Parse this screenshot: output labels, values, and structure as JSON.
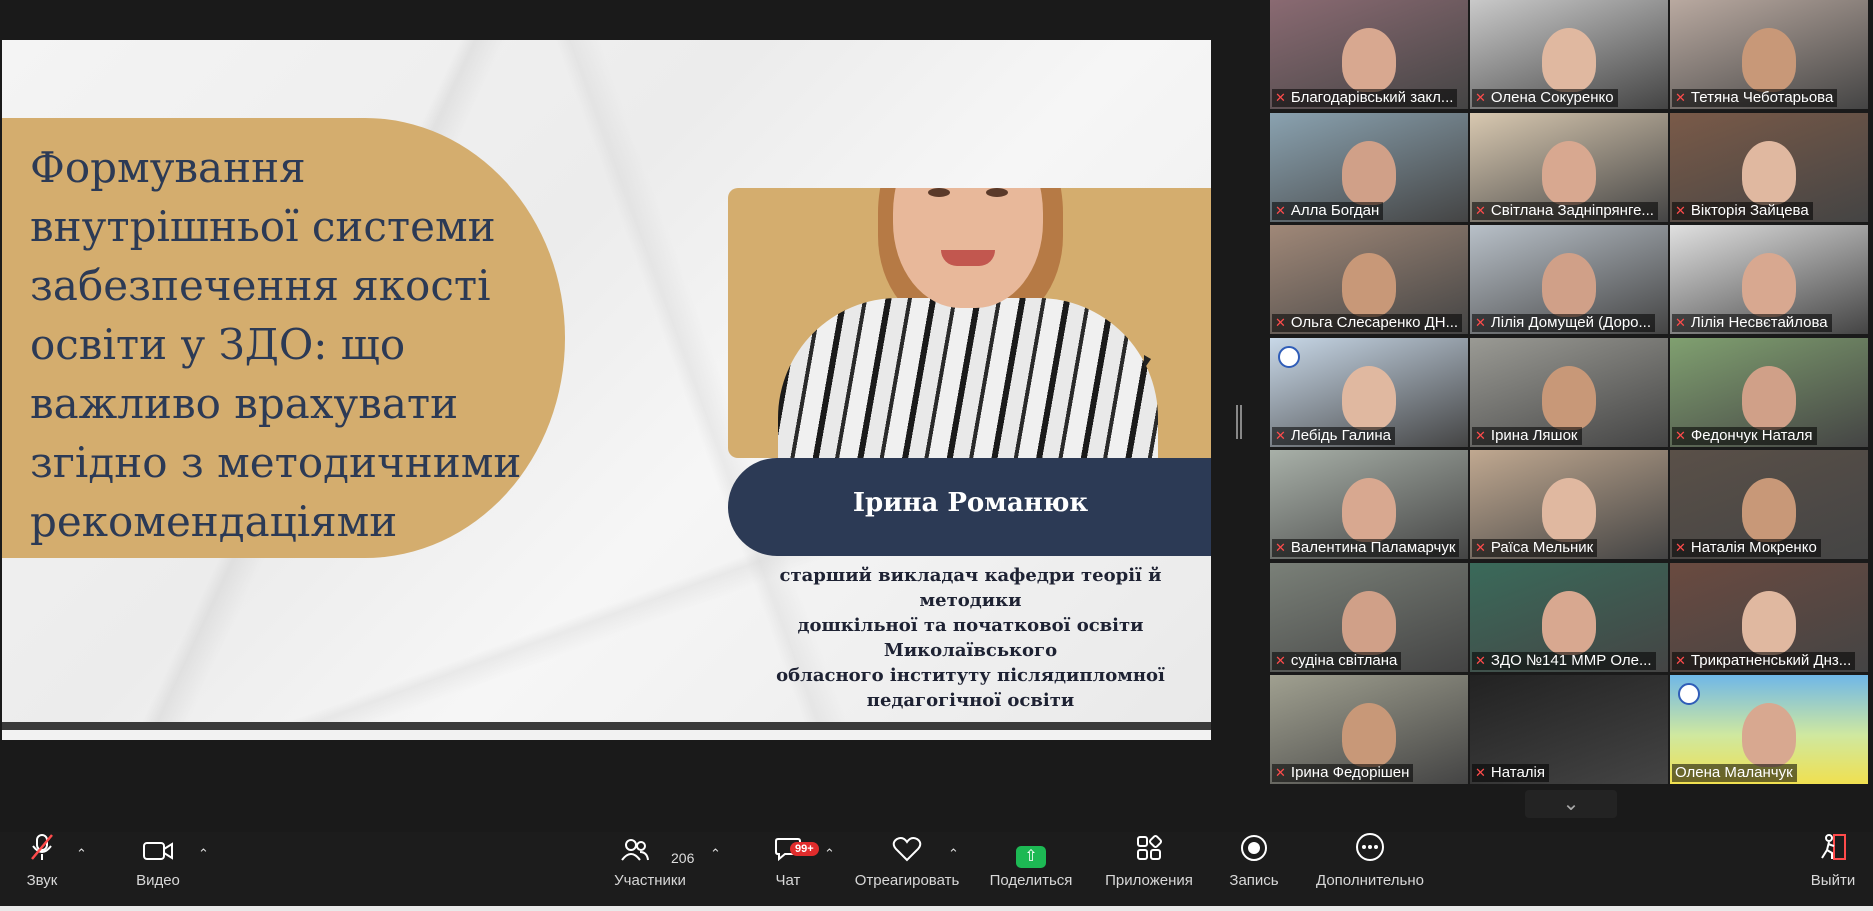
{
  "slide": {
    "title": " Формування\nвнутрішньої системи\nзабезпечення якості\nосвіти у ЗДО: що\nважливо врахувати\nзгідно з методичними\nрекомендаціями",
    "speaker_name": "Ірина Романюк",
    "speaker_role": "старший викладач кафедри теорії й методики\nдошкільної та початкової освіти Миколаївського\nобласного інституту післядипломної\nпедагогічної освіти"
  },
  "gallery": {
    "participants": [
      {
        "name": "Благодарівський закл...",
        "muted": true
      },
      {
        "name": "Олена Сокуренко",
        "muted": true
      },
      {
        "name": "Тетяна Чеботарьова",
        "muted": true
      },
      {
        "name": "Алла Богдан",
        "muted": true
      },
      {
        "name": "Світлана Задніпрянге...",
        "muted": true
      },
      {
        "name": "Вікторія Зайцева",
        "muted": true
      },
      {
        "name": "Ольга Слесаренко ДН...",
        "muted": true
      },
      {
        "name": "Лілія Домущей (Доро...",
        "muted": true
      },
      {
        "name": "Лілія Несвєтайлова",
        "muted": true
      },
      {
        "name": "Лебідь Галина",
        "muted": true
      },
      {
        "name": "Ірина Ляшок",
        "muted": true
      },
      {
        "name": "Федончук Наталя",
        "muted": true
      },
      {
        "name": "Валентина Паламарчук",
        "muted": true
      },
      {
        "name": "Раїса Мельник",
        "muted": true
      },
      {
        "name": "Наталія Мокренко",
        "muted": true
      },
      {
        "name": "судіна світлана",
        "muted": true
      },
      {
        "name": "ЗДО №141 ММР Оле...",
        "muted": true
      },
      {
        "name": "Трикратненський Днз...",
        "muted": true
      },
      {
        "name": "Ірина Федорішен",
        "muted": true
      },
      {
        "name": "Наталія",
        "muted": true
      },
      {
        "name": "Олена Маланчук",
        "muted": false,
        "active": true
      }
    ],
    "more_icon": "chevron-down-icon"
  },
  "toolbar": {
    "audio_label": "Звук",
    "video_label": "Видео",
    "participants_label": "Участники",
    "participants_count": "206",
    "chat_label": "Чат",
    "chat_badge": "99+",
    "react_label": "Отреагировать",
    "share_label": "Поделиться",
    "apps_label": "Приложения",
    "record_label": "Запись",
    "more_label": "Дополнительно",
    "leave_label": "Выйти"
  },
  "colors": {
    "accent_gold": "#d4ad6e",
    "navy": "#2c3a55",
    "share_green": "#1db954",
    "active_speaker": "#2ddf6a",
    "muted_red": "#ff4b4b"
  }
}
